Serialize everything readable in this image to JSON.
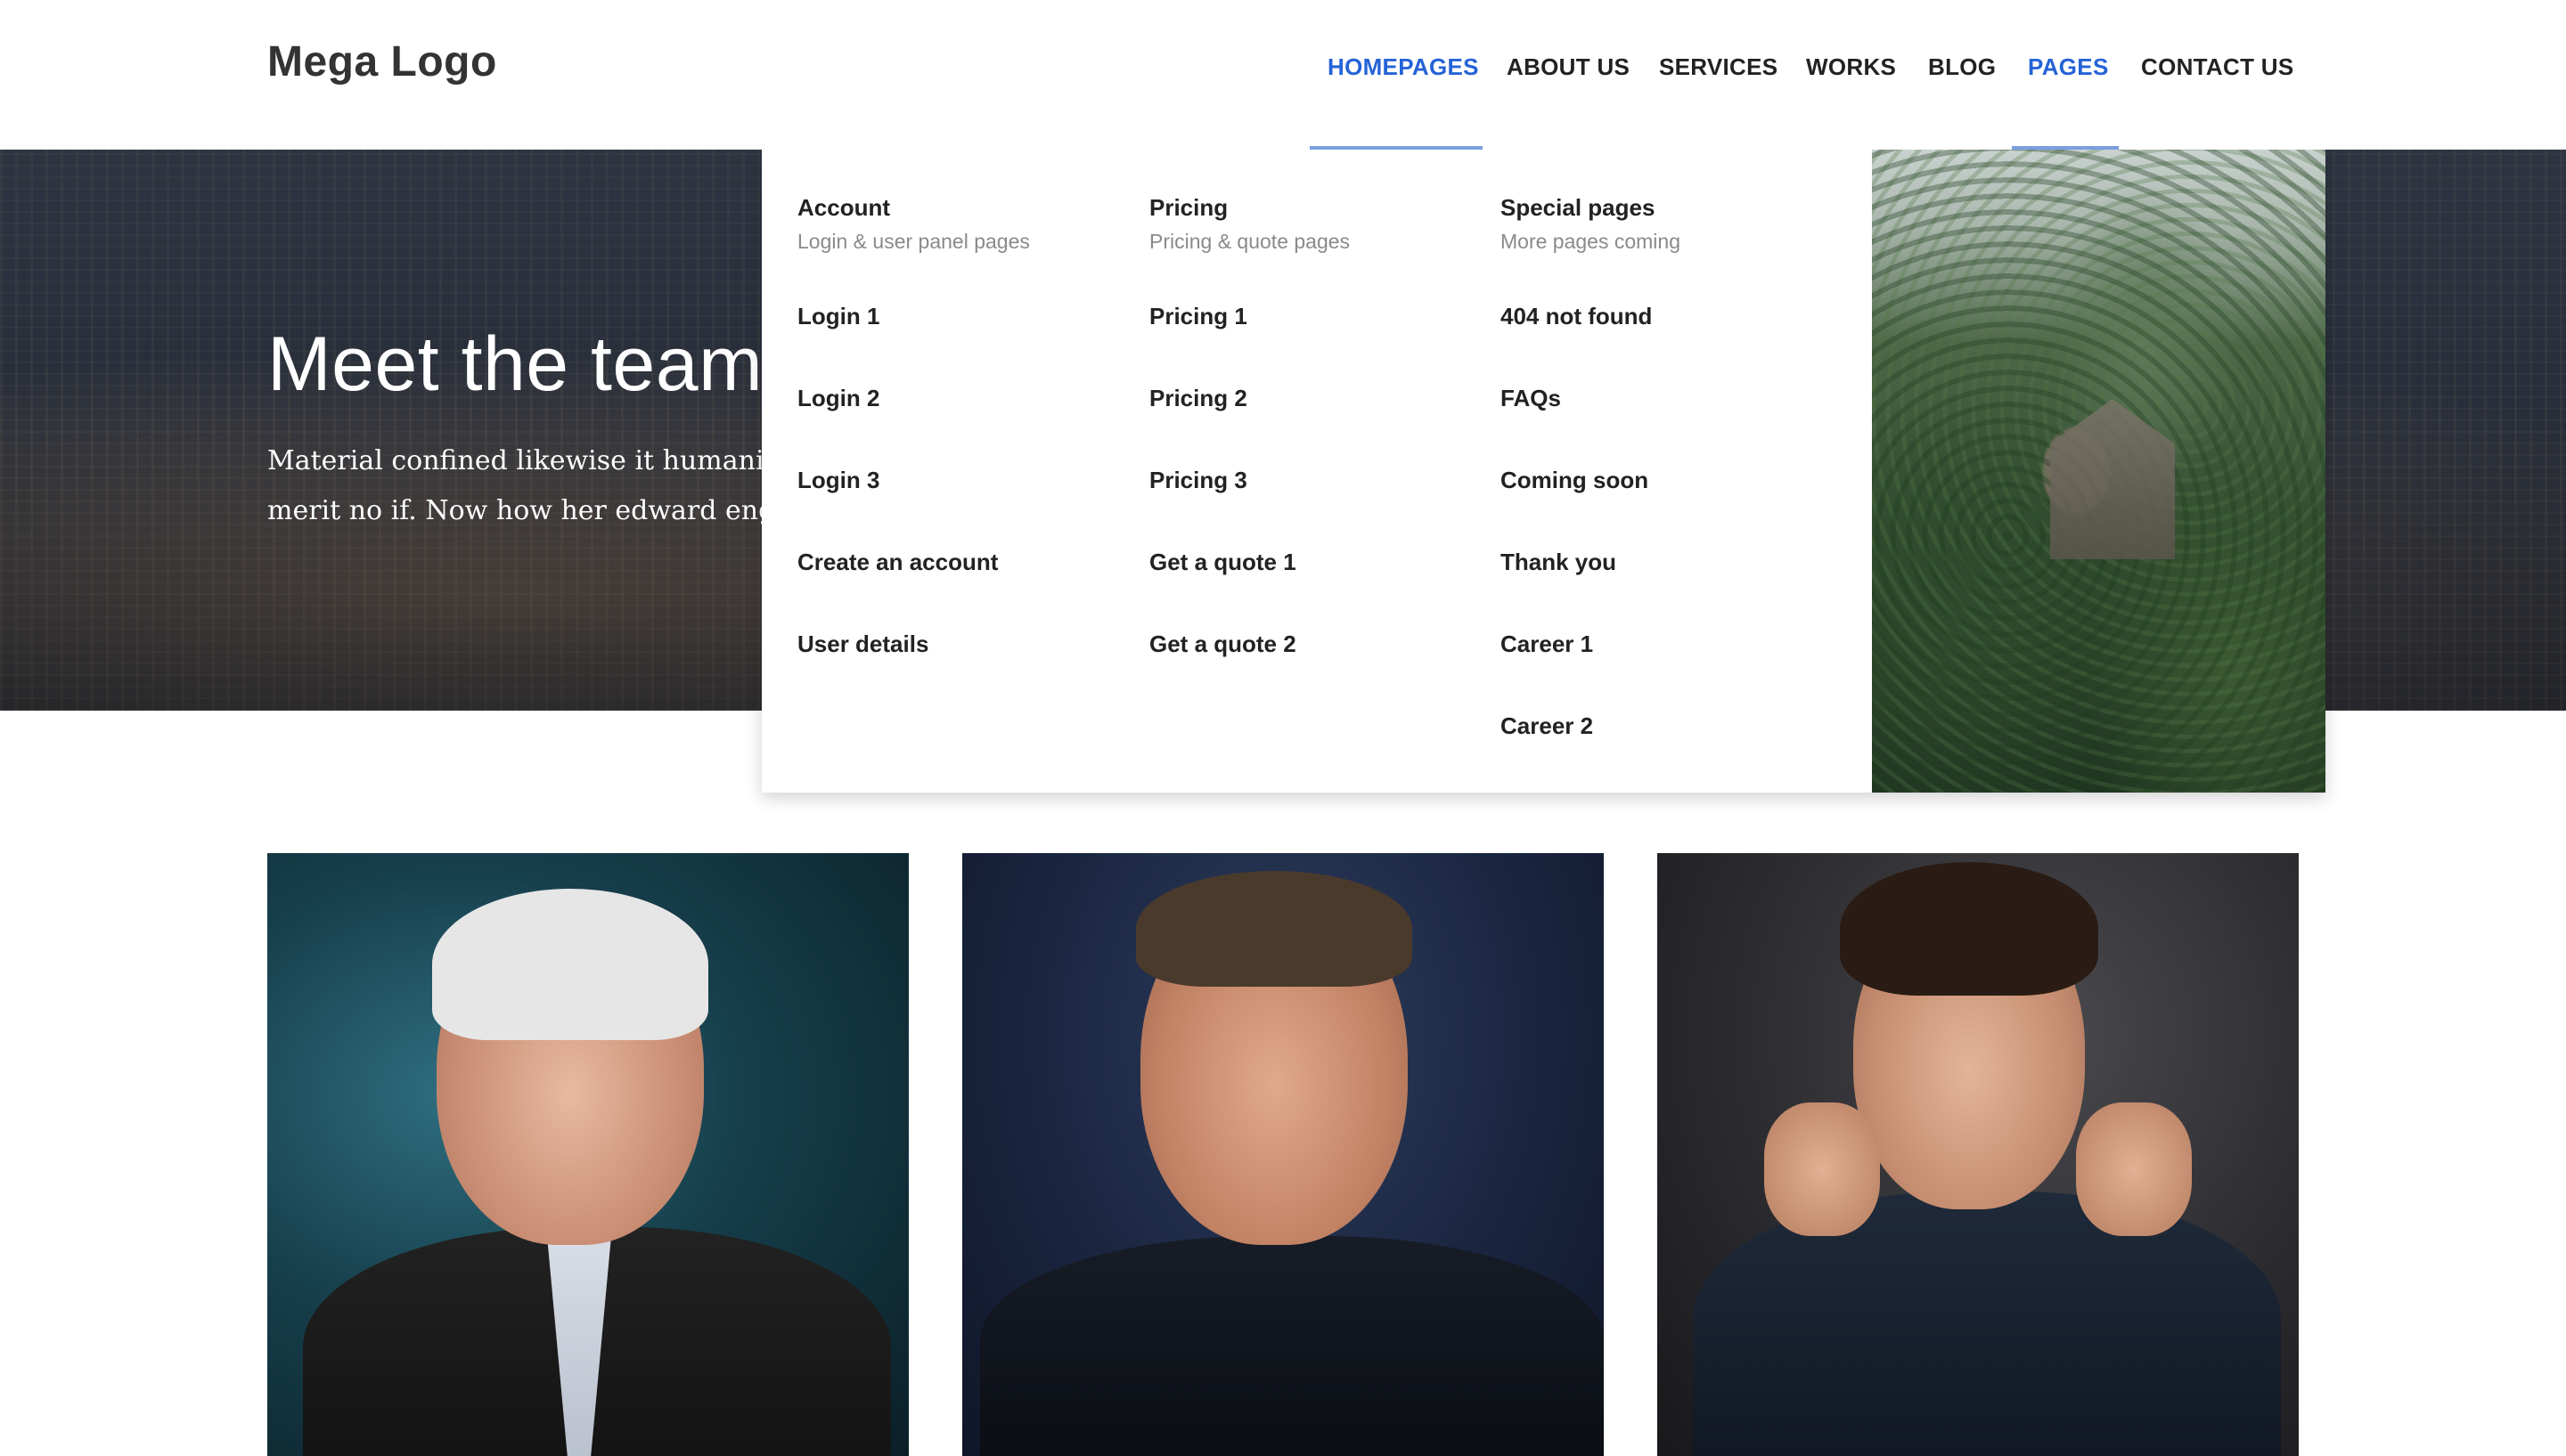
{
  "header": {
    "logo": "Mega Logo",
    "nav": [
      {
        "label": "HOMEPAGES",
        "active": true
      },
      {
        "label": "ABOUT US",
        "active": false
      },
      {
        "label": "SERVICES",
        "active": false
      },
      {
        "label": "WORKS",
        "active": false
      },
      {
        "label": "BLOG",
        "active": false
      },
      {
        "label": "PAGES",
        "active": true
      },
      {
        "label": "CONTACT US",
        "active": false
      }
    ],
    "accent_color": "#2563d6"
  },
  "hero": {
    "title": "Meet the team",
    "text_line1": "Material confined likewise it humanity ra",
    "text_line2": "merit no if. Now how her edward engage"
  },
  "mega_menu": {
    "columns": [
      {
        "title": "Account",
        "subtitle": "Login & user panel pages",
        "links": [
          "Login 1",
          "Login 2",
          "Login 3",
          "Create an account",
          "User details"
        ]
      },
      {
        "title": "Pricing",
        "subtitle": "Pricing & quote pages",
        "links": [
          "Pricing 1",
          "Pricing 2",
          "Pricing 3",
          "Get a quote 1",
          "Get a quote 2"
        ]
      },
      {
        "title": "Special pages",
        "subtitle": "More pages coming",
        "links": [
          "404 not found",
          "FAQs",
          "Coming soon",
          "Thank you",
          "Career 1",
          "Career 2"
        ]
      }
    ]
  }
}
